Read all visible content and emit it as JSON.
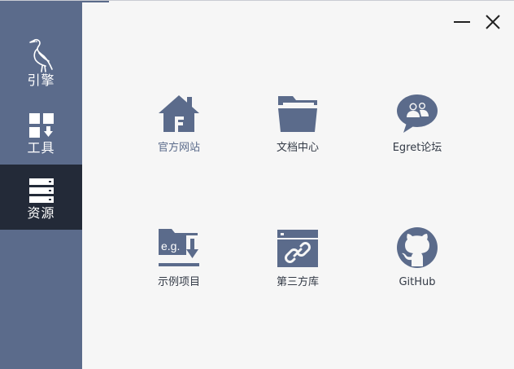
{
  "window": {
    "minimize_icon": "minimize-icon",
    "close_icon": "close-icon"
  },
  "sidebar": {
    "items": [
      {
        "label": "引擎",
        "icon": "egret-bird-icon",
        "active": false
      },
      {
        "label": "工具",
        "icon": "tools-grid-icon",
        "active": false
      },
      {
        "label": "资源",
        "icon": "resources-stack-icon",
        "active": true
      }
    ]
  },
  "resources": {
    "tiles": [
      {
        "label": "官方网站",
        "icon": "home-icon"
      },
      {
        "label": "文档中心",
        "icon": "folder-icon"
      },
      {
        "label": "Egret论坛",
        "icon": "forum-chat-icon"
      },
      {
        "label": "示例项目",
        "icon": "example-download-icon",
        "badge": "e.g."
      },
      {
        "label": "第三方库",
        "icon": "link-window-icon"
      },
      {
        "label": "GitHub",
        "icon": "github-icon"
      }
    ]
  },
  "colors": {
    "sidebar_bg": "#5b6b8b",
    "sidebar_active": "#232a38",
    "icon": "#5b6b8b",
    "content_bg": "#f6f6f6"
  }
}
